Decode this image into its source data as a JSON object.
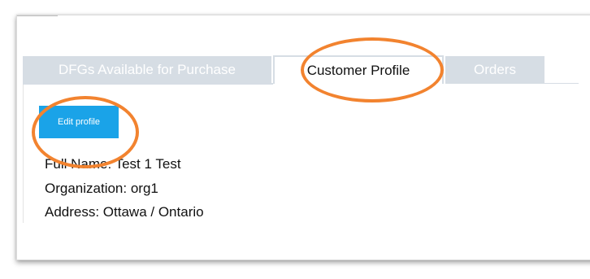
{
  "tabs": [
    {
      "label": "DFGs Available for Purchase",
      "active": false
    },
    {
      "label": "Customer Profile",
      "active": true
    },
    {
      "label": "Orders",
      "active": false
    }
  ],
  "profile": {
    "edit_label": "Edit profile",
    "full_name": "Full Name: Test 1 Test",
    "organization": "Organization: org1",
    "address": "Address: Ottawa / Ontario"
  },
  "colors": {
    "accent_button": "#1aa3e8",
    "inactive_tab": "#d6dde4",
    "highlight_circle": "#f2832f"
  }
}
